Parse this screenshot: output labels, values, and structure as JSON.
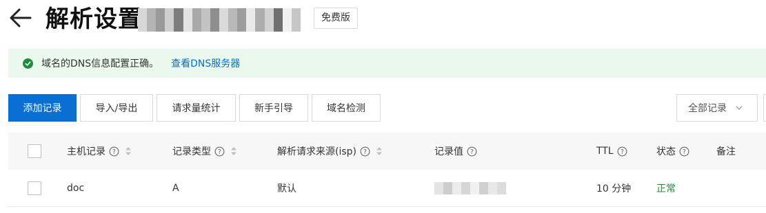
{
  "header": {
    "title": "解析设置",
    "edition_badge": "免费版"
  },
  "notice": {
    "message": "域名的DNS信息配置正确。",
    "link": "查看DNS服务器",
    "status_color": "#1e8e3e"
  },
  "toolbar": {
    "add_record": "添加记录",
    "import_export": "导入/导出",
    "request_stats": "请求量统计",
    "beginner_guide": "新手引导",
    "domain_check": "域名检测",
    "filter": "全部记录"
  },
  "table": {
    "columns": {
      "host": "主机记录",
      "type": "记录类型",
      "source": "解析请求来源(isp)",
      "value": "记录值",
      "ttl": "TTL",
      "status": "状态",
      "remark": "备注"
    },
    "rows": [
      {
        "host": "doc",
        "type": "A",
        "source": "默认",
        "ttl": "10 分钟",
        "status": "正常",
        "remark": ""
      }
    ]
  },
  "colors": {
    "primary": "#0a6fd2",
    "link": "#0070cc",
    "status_ok": "#1f8f34",
    "notice_bg": "#ebf8ee"
  }
}
